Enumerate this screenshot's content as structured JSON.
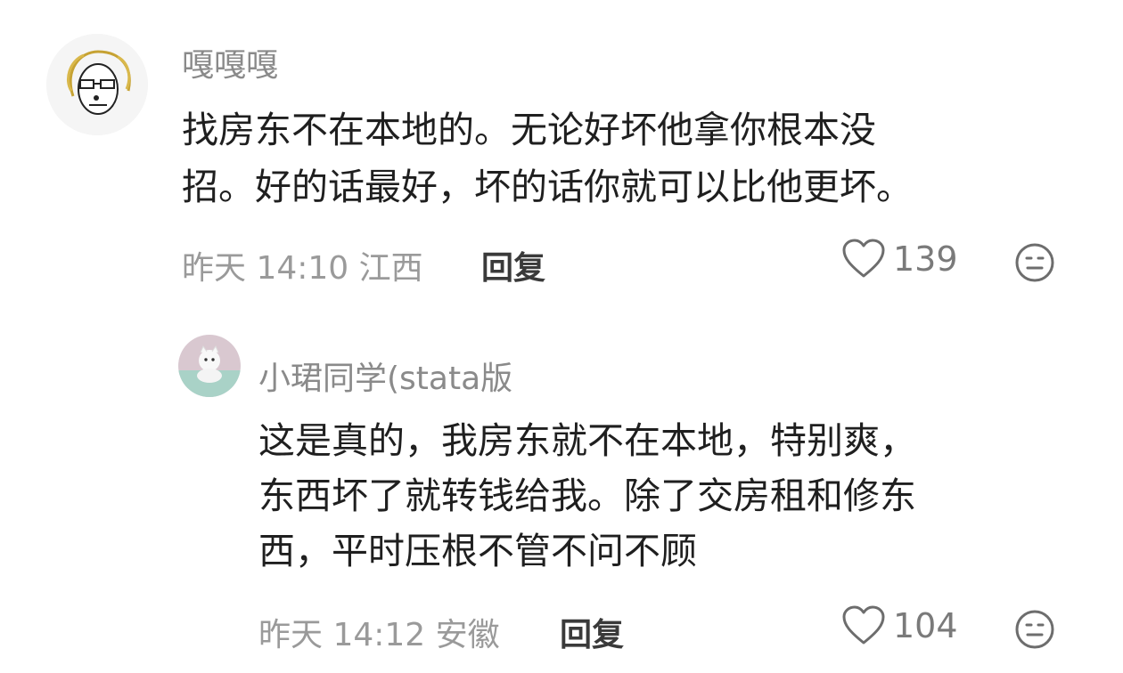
{
  "comment": {
    "username": "嘎嘎嘎",
    "lines": [
      "找房东不在本地的。无论好坏他拿你根本没",
      "招。好的话最好，坏的话你就可以比他更坏。"
    ],
    "time": "昨天 14:10",
    "location": "江西",
    "reply_label": "回复",
    "likes": "139"
  },
  "reply": {
    "username": "小珺同学(stata版",
    "lines": [
      "这是真的，我房东就不在本地，特别爽，",
      "东西坏了就转钱给我。除了交房租和修东",
      "西，平时压根不管不问不顾"
    ],
    "time": "昨天 14:12",
    "location": "安徽",
    "reply_label": "回复",
    "likes": "104"
  },
  "icons": {
    "like": "heart-outline-icon",
    "emoji": "neutral-face-icon"
  }
}
